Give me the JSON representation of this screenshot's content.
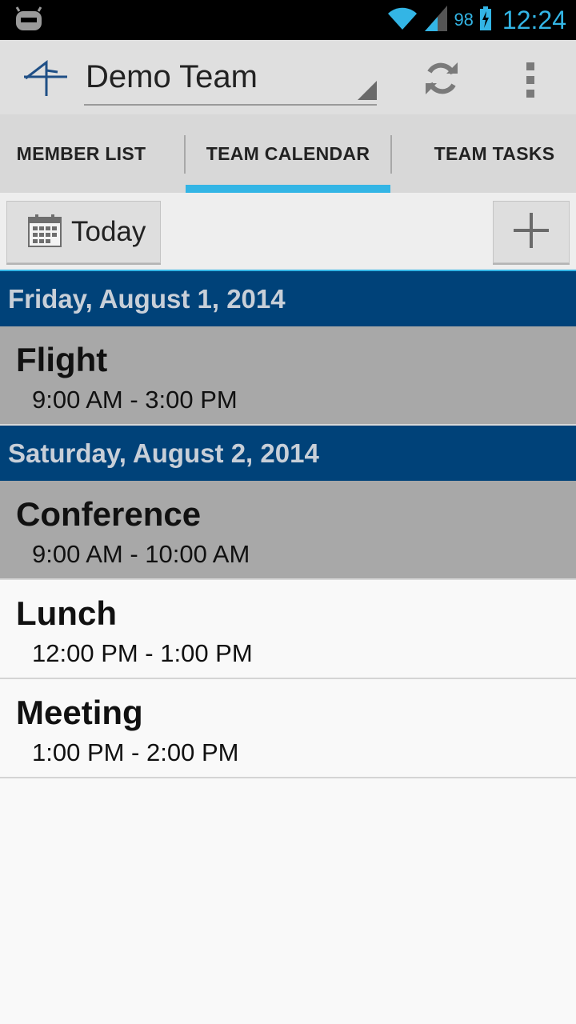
{
  "status_bar": {
    "battery_percent": "98",
    "time": "12:24",
    "icons": [
      "cyanogen-icon",
      "wifi-icon",
      "signal-icon",
      "battery-charging-icon"
    ]
  },
  "action_bar": {
    "team_name": "Demo Team",
    "icons": [
      "app-logo-icon",
      "refresh-icon",
      "overflow-menu-icon"
    ]
  },
  "tabs": [
    {
      "label": "MEMBER LIST",
      "selected": false
    },
    {
      "label": "TEAM CALENDAR",
      "selected": true
    },
    {
      "label": "TEAM TASKS",
      "selected": false
    }
  ],
  "toolbar": {
    "today_label": "Today",
    "icons": [
      "calendar-icon",
      "add-icon"
    ]
  },
  "agenda": [
    {
      "date": "Friday, August 1, 2014",
      "events": [
        {
          "title": "Flight",
          "time": "9:00 AM - 3:00 PM",
          "past": true
        }
      ]
    },
    {
      "date": "Saturday, August 2, 2014",
      "events": [
        {
          "title": "Conference",
          "time": "9:00 AM - 10:00 AM",
          "past": true
        },
        {
          "title": "Lunch",
          "time": "12:00 PM - 1:00 PM",
          "past": false
        },
        {
          "title": "Meeting",
          "time": "1:00 PM - 2:00 PM",
          "past": false
        }
      ]
    }
  ],
  "colors": {
    "accent": "#33b5e5",
    "day_header_bg": "#004279",
    "past_event_bg": "#a8a8a8"
  }
}
